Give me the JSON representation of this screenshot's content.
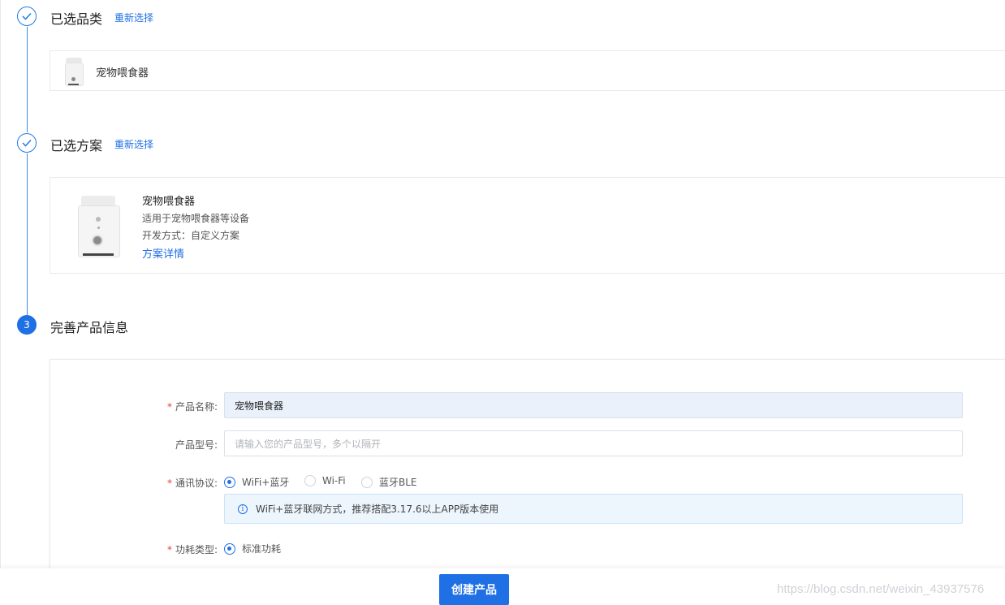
{
  "steps": [
    {
      "title": "已选品类",
      "reselect": "重新选择"
    },
    {
      "title": "已选方案",
      "reselect": "重新选择"
    },
    {
      "number": "3",
      "title": "完善产品信息"
    }
  ],
  "category_card": {
    "name": "宠物喂食器"
  },
  "scheme_card": {
    "name": "宠物喂食器",
    "desc": "适用于宠物喂食器等设备",
    "dev_mode": "开发方式：自定义方案",
    "details_link": "方案详情"
  },
  "form": {
    "required_mark": "*",
    "product_name": {
      "label": "产品名称:",
      "value": "宠物喂食器"
    },
    "product_model": {
      "label": "产品型号:",
      "placeholder": "请输入您的产品型号，多个以隔开"
    },
    "protocol": {
      "label": "通讯协议:",
      "options": [
        "WiFi+蓝牙",
        "Wi-Fi",
        "蓝牙BLE"
      ],
      "selected": "WiFi+蓝牙",
      "notice": "WiFi+蓝牙联网方式，推荐搭配3.17.6以上APP版本使用"
    },
    "power": {
      "label": "功耗类型:",
      "options": [
        "标准功耗"
      ],
      "selected": "标准功耗"
    }
  },
  "footer": {
    "create_button": "创建产品"
  },
  "watermark": "https://blog.csdn.net/weixin_43937576",
  "colors": {
    "primary": "#1f6fe5",
    "required": "#e5412d",
    "notice_bg": "#eef6fd"
  }
}
